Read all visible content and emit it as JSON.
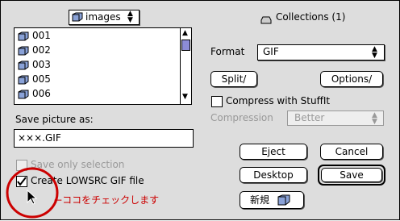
{
  "folder_popup": {
    "label": "images"
  },
  "file_list": [
    {
      "name": "001"
    },
    {
      "name": "002"
    },
    {
      "name": "003"
    },
    {
      "name": "005"
    },
    {
      "name": "006"
    }
  ],
  "collections": {
    "label": "Collections (1)"
  },
  "save_as": {
    "label": "Save picture as:",
    "value": "×××.GIF"
  },
  "save_selection": {
    "label": "Save only selection",
    "checked": false,
    "enabled": false
  },
  "lowsrc": {
    "label": "Create LOWSRC GIF file",
    "checked": true
  },
  "annotation": {
    "text": "ココをチェックします",
    "color": "#cc0000"
  },
  "format": {
    "label": "Format",
    "value": "GIF"
  },
  "buttons": {
    "split": "Split/",
    "options": "Options/",
    "eject": "Eject",
    "cancel": "Cancel",
    "desktop": "Desktop",
    "save": "Save",
    "new_folder": "新規"
  },
  "compress": {
    "label": "Compress with StuffIt",
    "checked": false
  },
  "compression": {
    "label": "Compression",
    "value": "Better",
    "enabled": false
  }
}
